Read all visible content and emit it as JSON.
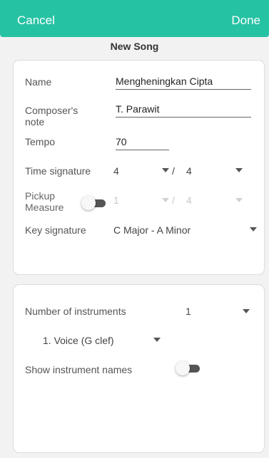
{
  "topbar": {
    "cancel_label": "Cancel",
    "done_label": "Done"
  },
  "page_title": "New Song",
  "song_form": {
    "name_label": "Name",
    "name_value": "Mengheningkan Cipta",
    "composer_label": "Composer's note",
    "composer_value": "T. Parawit",
    "tempo_label": "Tempo",
    "tempo_value": "70",
    "time_signature_label": "Time signature",
    "time_signature_top": "4",
    "time_signature_separator": "/",
    "time_signature_bottom": "4",
    "pickup_label": "Pickup Measure",
    "pickup_top": "1",
    "pickup_separator": "/",
    "pickup_bottom": "4",
    "key_signature_label": "Key signature",
    "key_signature_value": "C Major - A Minor"
  },
  "instruments": {
    "count_label": "Number of instruments",
    "count_value": "1",
    "instrument_1": "1.  Voice (G clef)",
    "show_names_label": "Show instrument names"
  },
  "colors": {
    "accent": "#26c2a4"
  }
}
